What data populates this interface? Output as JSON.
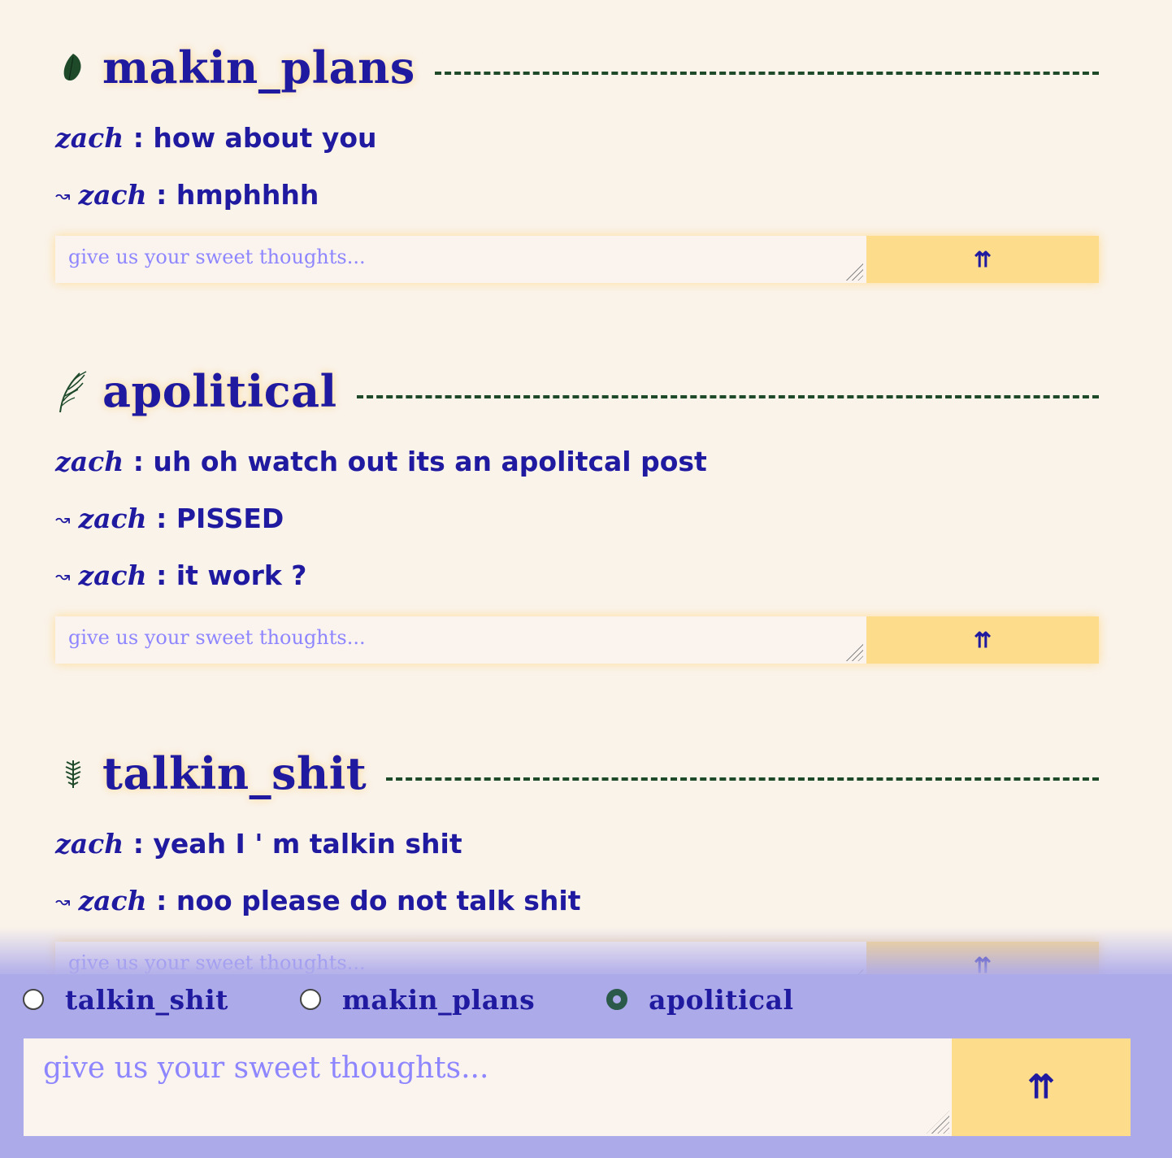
{
  "topics": [
    {
      "title": "makin_plans",
      "icon": "leaf-icon",
      "messages": [
        {
          "reply": false,
          "author": "zach",
          "sep": " : ",
          "text": "how about you"
        },
        {
          "reply": true,
          "arrow": "↝",
          "author": "zach",
          "sep": " : ",
          "text": "hmphhhh"
        }
      ],
      "composer": {
        "placeholder": "give us your sweet thoughts...",
        "send_label": "⇈"
      }
    },
    {
      "title": "apolitical",
      "icon": "fern-frond-icon",
      "messages": [
        {
          "reply": false,
          "author": "zach",
          "sep": " : ",
          "text": "uh oh watch out its an apolitcal post"
        },
        {
          "reply": true,
          "arrow": "↝",
          "author": "zach",
          "sep": " : ",
          "text": "PISSED"
        },
        {
          "reply": true,
          "arrow": "↝",
          "author": "zach",
          "sep": " : ",
          "text": "it work ?"
        }
      ],
      "composer": {
        "placeholder": "give us your sweet thoughts...",
        "send_label": "⇈"
      }
    },
    {
      "title": "talkin_shit",
      "icon": "fern-sprig-icon",
      "messages": [
        {
          "reply": false,
          "author": "zach",
          "sep": " : ",
          "text": "yeah I ' m talkin shit"
        },
        {
          "reply": true,
          "arrow": "↝",
          "author": "zach",
          "sep": " : ",
          "text": "noo please do not talk shit"
        }
      ],
      "composer": {
        "placeholder": "give us your sweet thoughts...",
        "send_label": "⇈"
      }
    }
  ],
  "bottom": {
    "channels": [
      {
        "label": "talkin_shit",
        "checked": false
      },
      {
        "label": "makin_plans",
        "checked": false
      },
      {
        "label": "apolitical",
        "checked": true
      }
    ],
    "composer": {
      "placeholder": "give us your sweet thoughts...",
      "send_label": "⇈"
    }
  },
  "colors": {
    "background": "#faf3ea",
    "text": "#1f1aa0",
    "rule": "#1e4a2a",
    "send_button": "#fddc8c",
    "bottom_bar": "#adaaea",
    "placeholder": "#8e86ff"
  }
}
